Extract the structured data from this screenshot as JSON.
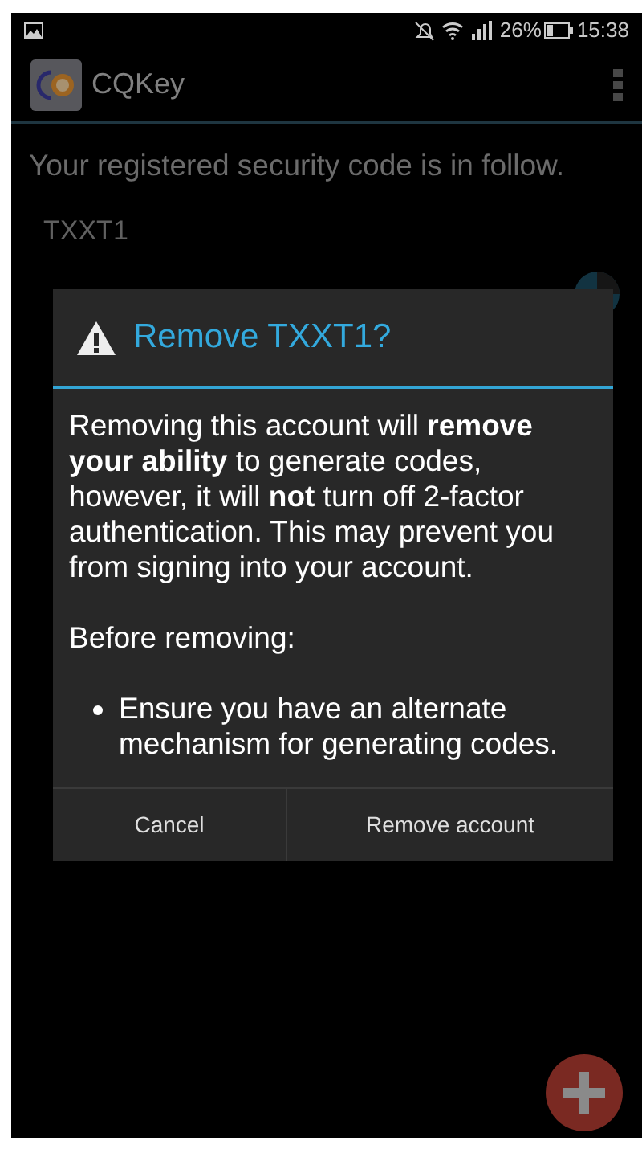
{
  "status_bar": {
    "battery": "26%",
    "time": "15:38"
  },
  "app_bar": {
    "title": "CQKey"
  },
  "content": {
    "intro": "Your registered security code is in follow.",
    "account": {
      "name": "TXXT1"
    }
  },
  "dialog": {
    "title": "Remove TXXT1?",
    "message": "Removing this account will **remove your ability** to generate codes, however, it will **not** turn off 2-factor authentication. This may prevent you from signing into your account.",
    "subheading": "Before removing:",
    "bullets": [
      "Ensure you have an alternate mechanism for generating codes."
    ],
    "buttons": [
      "Cancel",
      "Remove account"
    ]
  }
}
